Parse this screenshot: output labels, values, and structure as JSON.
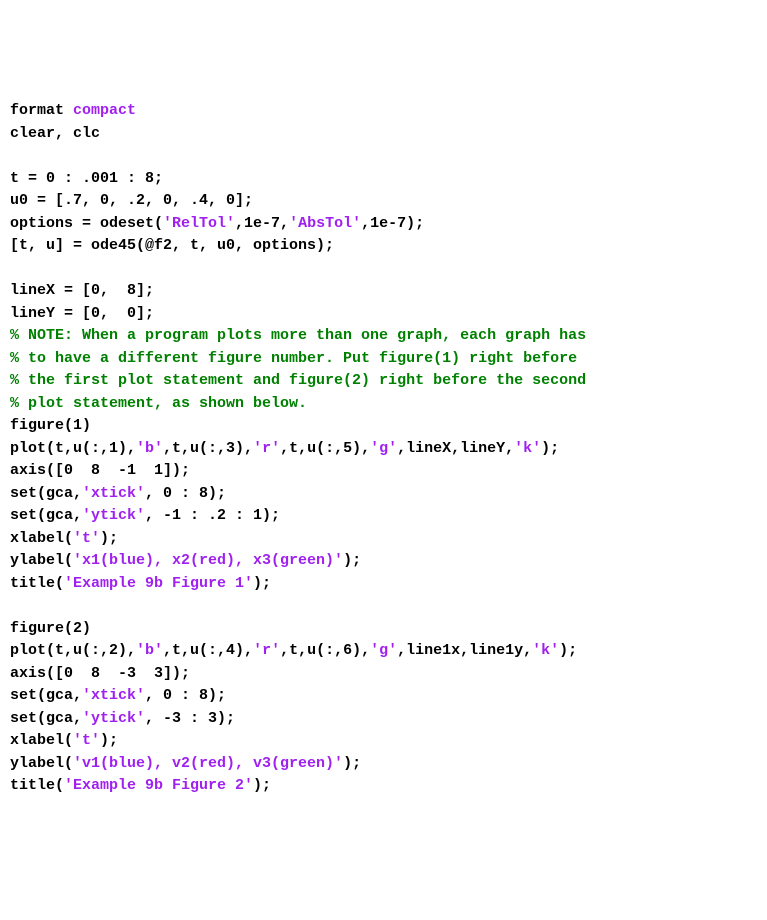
{
  "lines": [
    {
      "id": 0,
      "parts": [
        {
          "cls": "n",
          "text": "format "
        },
        {
          "cls": "s",
          "text": "compact"
        }
      ]
    },
    {
      "id": 1,
      "parts": [
        {
          "cls": "n",
          "text": "clear, clc"
        }
      ]
    },
    {
      "id": 2,
      "parts": [
        {
          "cls": "n",
          "text": ""
        }
      ]
    },
    {
      "id": 3,
      "parts": [
        {
          "cls": "n",
          "text": "t = 0 : .001 : 8;"
        }
      ]
    },
    {
      "id": 4,
      "parts": [
        {
          "cls": "n",
          "text": "u0 = [.7, 0, .2, 0, .4, 0];"
        }
      ]
    },
    {
      "id": 5,
      "parts": [
        {
          "cls": "n",
          "text": "options = odeset("
        },
        {
          "cls": "s",
          "text": "'RelTol'"
        },
        {
          "cls": "n",
          "text": ",1e-7,"
        },
        {
          "cls": "s",
          "text": "'AbsTol'"
        },
        {
          "cls": "n",
          "text": ",1e-7);"
        }
      ]
    },
    {
      "id": 6,
      "parts": [
        {
          "cls": "n",
          "text": "[t, u] = ode45(@f2, t, u0, options);"
        }
      ]
    },
    {
      "id": 7,
      "parts": [
        {
          "cls": "n",
          "text": ""
        }
      ]
    },
    {
      "id": 8,
      "parts": [
        {
          "cls": "n",
          "text": "lineX = [0,  8];"
        }
      ]
    },
    {
      "id": 9,
      "parts": [
        {
          "cls": "n",
          "text": "lineY = [0,  0];"
        }
      ]
    },
    {
      "id": 10,
      "parts": [
        {
          "cls": "c",
          "text": "% NOTE: When a program plots more than one graph, each graph has"
        }
      ]
    },
    {
      "id": 11,
      "parts": [
        {
          "cls": "c",
          "text": "% to have a different figure number. Put figure(1) right before"
        }
      ]
    },
    {
      "id": 12,
      "parts": [
        {
          "cls": "c",
          "text": "% the first plot statement and figure(2) right before the second"
        }
      ]
    },
    {
      "id": 13,
      "parts": [
        {
          "cls": "c",
          "text": "% plot statement, as shown below."
        }
      ]
    },
    {
      "id": 14,
      "parts": [
        {
          "cls": "n",
          "text": "figure(1)"
        }
      ]
    },
    {
      "id": 15,
      "parts": [
        {
          "cls": "n",
          "text": "plot(t,u(:,1),"
        },
        {
          "cls": "s",
          "text": "'b'"
        },
        {
          "cls": "n",
          "text": ",t,u(:,3),"
        },
        {
          "cls": "s",
          "text": "'r'"
        },
        {
          "cls": "n",
          "text": ",t,u(:,5),"
        },
        {
          "cls": "s",
          "text": "'g'"
        },
        {
          "cls": "n",
          "text": ",lineX,lineY,"
        },
        {
          "cls": "s",
          "text": "'k'"
        },
        {
          "cls": "n",
          "text": ");"
        }
      ]
    },
    {
      "id": 16,
      "parts": [
        {
          "cls": "n",
          "text": "axis([0  8  -1  1]);"
        }
      ]
    },
    {
      "id": 17,
      "parts": [
        {
          "cls": "n",
          "text": "set(gca,"
        },
        {
          "cls": "s",
          "text": "'xtick'"
        },
        {
          "cls": "n",
          "text": ", 0 : 8);"
        }
      ]
    },
    {
      "id": 18,
      "parts": [
        {
          "cls": "n",
          "text": "set(gca,"
        },
        {
          "cls": "s",
          "text": "'ytick'"
        },
        {
          "cls": "n",
          "text": ", -1 : .2 : 1);"
        }
      ]
    },
    {
      "id": 19,
      "parts": [
        {
          "cls": "n",
          "text": "xlabel("
        },
        {
          "cls": "s",
          "text": "'t'"
        },
        {
          "cls": "n",
          "text": ");"
        }
      ]
    },
    {
      "id": 20,
      "parts": [
        {
          "cls": "n",
          "text": "ylabel("
        },
        {
          "cls": "s",
          "text": "'x1(blue), x2(red), x3(green)'"
        },
        {
          "cls": "n",
          "text": ");"
        }
      ]
    },
    {
      "id": 21,
      "parts": [
        {
          "cls": "n",
          "text": "title("
        },
        {
          "cls": "s",
          "text": "'Example 9b Figure 1'"
        },
        {
          "cls": "n",
          "text": ");"
        }
      ]
    },
    {
      "id": 22,
      "parts": [
        {
          "cls": "n",
          "text": ""
        }
      ]
    },
    {
      "id": 23,
      "parts": [
        {
          "cls": "n",
          "text": "figure(2)"
        }
      ]
    },
    {
      "id": 24,
      "parts": [
        {
          "cls": "n",
          "text": "plot(t,u(:,2),"
        },
        {
          "cls": "s",
          "text": "'b'"
        },
        {
          "cls": "n",
          "text": ",t,u(:,4),"
        },
        {
          "cls": "s",
          "text": "'r'"
        },
        {
          "cls": "n",
          "text": ",t,u(:,6),"
        },
        {
          "cls": "s",
          "text": "'g'"
        },
        {
          "cls": "n",
          "text": ",line1x,line1y,"
        },
        {
          "cls": "s",
          "text": "'k'"
        },
        {
          "cls": "n",
          "text": ");"
        }
      ]
    },
    {
      "id": 25,
      "parts": [
        {
          "cls": "n",
          "text": "axis([0  8  -3  3]);"
        }
      ]
    },
    {
      "id": 26,
      "parts": [
        {
          "cls": "n",
          "text": "set(gca,"
        },
        {
          "cls": "s",
          "text": "'xtick'"
        },
        {
          "cls": "n",
          "text": ", 0 : 8);"
        }
      ]
    },
    {
      "id": 27,
      "parts": [
        {
          "cls": "n",
          "text": "set(gca,"
        },
        {
          "cls": "s",
          "text": "'ytick'"
        },
        {
          "cls": "n",
          "text": ", -3 : 3);"
        }
      ]
    },
    {
      "id": 28,
      "parts": [
        {
          "cls": "n",
          "text": "xlabel("
        },
        {
          "cls": "s",
          "text": "'t'"
        },
        {
          "cls": "n",
          "text": ");"
        }
      ]
    },
    {
      "id": 29,
      "parts": [
        {
          "cls": "n",
          "text": "ylabel("
        },
        {
          "cls": "s",
          "text": "'v1(blue), v2(red), v3(green)'"
        },
        {
          "cls": "n",
          "text": ");"
        }
      ]
    },
    {
      "id": 30,
      "parts": [
        {
          "cls": "n",
          "text": "title("
        },
        {
          "cls": "s",
          "text": "'Example 9b Figure 2'"
        },
        {
          "cls": "n",
          "text": ");"
        }
      ]
    }
  ]
}
